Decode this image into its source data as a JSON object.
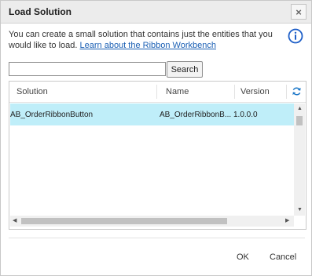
{
  "dialog": {
    "title": "Load Solution",
    "close_label": "×",
    "description": "You can create a small solution that contains just the entities that you would like to load.",
    "learn_link": "Learn about the Ribbon Workbench"
  },
  "search": {
    "value": "",
    "placeholder": "",
    "button_label": "Search"
  },
  "grid": {
    "columns": [
      "Solution",
      "Name",
      "Version"
    ],
    "rows": [
      {
        "solution": "AB_OrderRibbonButton",
        "name": "AB_OrderRibbonB...",
        "version": "1.0.0.0",
        "selected": true
      }
    ]
  },
  "footer": {
    "ok_label": "OK",
    "cancel_label": "Cancel"
  },
  "colors": {
    "selected_row": "#bfeef9",
    "link": "#1a5fb4",
    "info": "#1e5fc8"
  }
}
